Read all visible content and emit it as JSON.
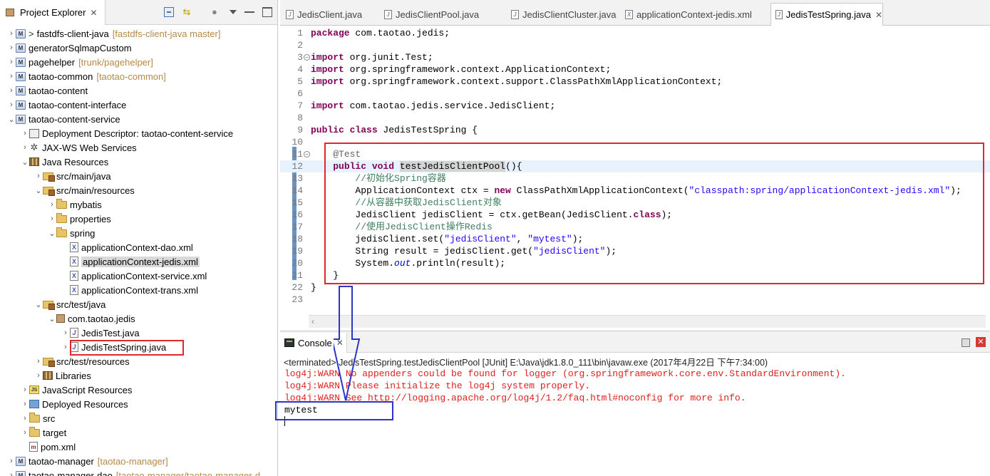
{
  "explorer": {
    "tab_label": "Project Explorer",
    "close_glyph": "✕",
    "tree": [
      {
        "arrow": "›",
        "indent": 0,
        "icon": "project",
        "prefix": ">",
        "label": "fastdfs-client-java",
        "svn": "[fastdfs-client-java master]"
      },
      {
        "arrow": "›",
        "indent": 0,
        "icon": "project",
        "label": "generatorSqlmapCustom"
      },
      {
        "arrow": "›",
        "indent": 0,
        "icon": "project",
        "label": "pagehelper",
        "svn": "[trunk/pagehelper]"
      },
      {
        "arrow": "›",
        "indent": 0,
        "icon": "project",
        "label": "taotao-common",
        "svn": "[taotao-common]"
      },
      {
        "arrow": "›",
        "indent": 0,
        "icon": "project",
        "label": "taotao-content"
      },
      {
        "arrow": "›",
        "indent": 0,
        "icon": "project",
        "label": "taotao-content-interface"
      },
      {
        "arrow": "⌄",
        "indent": 0,
        "icon": "project",
        "label": "taotao-content-service"
      },
      {
        "arrow": "›",
        "indent": 1,
        "icon": "dd",
        "label": "Deployment Descriptor: taotao-content-service"
      },
      {
        "arrow": "›",
        "indent": 1,
        "icon": "jaxws",
        "label": "JAX-WS Web Services"
      },
      {
        "arrow": "⌄",
        "indent": 1,
        "icon": "lib",
        "label": "Java Resources"
      },
      {
        "arrow": "›",
        "indent": 2,
        "icon": "pkgfolder",
        "label": "src/main/java"
      },
      {
        "arrow": "⌄",
        "indent": 2,
        "icon": "pkgfolder",
        "label": "src/main/resources"
      },
      {
        "arrow": "›",
        "indent": 3,
        "icon": "folder",
        "label": "mybatis"
      },
      {
        "arrow": "›",
        "indent": 3,
        "icon": "folder",
        "label": "properties"
      },
      {
        "arrow": "⌄",
        "indent": 3,
        "icon": "folder",
        "label": "spring"
      },
      {
        "arrow": "",
        "indent": 4,
        "icon": "xml",
        "label": "applicationContext-dao.xml"
      },
      {
        "arrow": "",
        "indent": 4,
        "icon": "xml",
        "label": "applicationContext-jedis.xml",
        "selected": true
      },
      {
        "arrow": "",
        "indent": 4,
        "icon": "xml",
        "label": "applicationContext-service.xml"
      },
      {
        "arrow": "",
        "indent": 4,
        "icon": "xml",
        "label": "applicationContext-trans.xml"
      },
      {
        "arrow": "⌄",
        "indent": 2,
        "icon": "pkgfolder",
        "label": "src/test/java"
      },
      {
        "arrow": "⌄",
        "indent": 3,
        "icon": "package",
        "label": "com.taotao.jedis"
      },
      {
        "arrow": "›",
        "indent": 4,
        "icon": "java",
        "label": "JedisTest.java"
      },
      {
        "arrow": "›",
        "indent": 4,
        "icon": "java",
        "label": "JedisTestSpring.java",
        "boxed": true
      },
      {
        "arrow": "›",
        "indent": 2,
        "icon": "pkgfolder",
        "label": "src/test/resources"
      },
      {
        "arrow": "›",
        "indent": 2,
        "icon": "lib",
        "label": "Libraries"
      },
      {
        "arrow": "›",
        "indent": 1,
        "icon": "js",
        "label": "JavaScript Resources"
      },
      {
        "arrow": "›",
        "indent": 1,
        "icon": "deploy",
        "label": "Deployed Resources"
      },
      {
        "arrow": "›",
        "indent": 1,
        "icon": "folder",
        "label": "src"
      },
      {
        "arrow": "›",
        "indent": 1,
        "icon": "folder",
        "label": "target"
      },
      {
        "arrow": "",
        "indent": 1,
        "icon": "pom",
        "label": "pom.xml"
      },
      {
        "arrow": "›",
        "indent": 0,
        "icon": "project",
        "label": "taotao-manager",
        "svn": "[taotao-manager]"
      },
      {
        "arrow": "›",
        "indent": 0,
        "icon": "project",
        "label": "taotao-manager-dao",
        "svn": "[taotao-manager/taotao-manager-d"
      }
    ]
  },
  "editor": {
    "tabs": [
      {
        "label": "JedisClient.java",
        "icon": "J"
      },
      {
        "label": "JedisClientPool.java",
        "icon": "J"
      },
      {
        "label": "JedisClientCluster.java",
        "icon": "J"
      },
      {
        "label": "applicationContext-jedis.xml",
        "icon": "X"
      },
      {
        "label": "JedisTestSpring.java",
        "icon": "J",
        "active": true,
        "close": "✕"
      }
    ],
    "lines": [
      {
        "n": "1",
        "html": "<span class=\"kw\">package</span> com.taotao.jedis;"
      },
      {
        "n": "2",
        "html": ""
      },
      {
        "n": "3",
        "html": "<span class=\"kw\">import</span> org.junit.Test;"
      },
      {
        "n": "4",
        "html": "<span class=\"kw\">import</span> org.springframework.context.ApplicationContext;"
      },
      {
        "n": "5",
        "html": "<span class=\"kw\">import</span> org.springframework.context.support.ClassPathXmlApplicationContext;"
      },
      {
        "n": "6",
        "html": ""
      },
      {
        "n": "7",
        "html": "<span class=\"kw\">import</span> com.taotao.jedis.service.JedisClient;"
      },
      {
        "n": "8",
        "html": ""
      },
      {
        "n": "9",
        "html": "<span class=\"kw\">public class</span> JedisTestSpring {"
      },
      {
        "n": "10",
        "html": ""
      },
      {
        "n": "11",
        "html": "    <span class=\"ann\">@Test</span>"
      },
      {
        "n": "12",
        "html": "    <span class=\"kw\">public void</span> <span class=\"occurrence\">testJedisClientPool</span>(){",
        "current": true
      },
      {
        "n": "13",
        "html": "        <span class=\"com\">//初始化Spring容器</span>"
      },
      {
        "n": "14",
        "html": "        ApplicationContext ctx = <span class=\"kw\">new</span> ClassPathXmlApplicationContext(<span class=\"str\">\"classpath:spring/applicationContext-jedis.xml\"</span>);"
      },
      {
        "n": "15",
        "html": "        <span class=\"com\">//从容器中获取JedisClient对象</span>"
      },
      {
        "n": "16",
        "html": "        JedisClient jedisClient = ctx.getBean(JedisClient.<span class=\"kw\">class</span>);"
      },
      {
        "n": "17",
        "html": "        <span class=\"com\">//使用JedisClient操作Redis</span>"
      },
      {
        "n": "18",
        "html": "        jedisClient.set(<span class=\"str\">\"jedisClient\"</span>, <span class=\"str\">\"mytest\"</span>);"
      },
      {
        "n": "19",
        "html": "        String result = jedisClient.get(<span class=\"str\">\"jedisClient\"</span>);"
      },
      {
        "n": "20",
        "html": "        System.<span class=\"fld\">out</span>.println(result);"
      },
      {
        "n": "21",
        "html": "    }"
      },
      {
        "n": "22",
        "html": "}"
      },
      {
        "n": "23",
        "html": ""
      }
    ]
  },
  "console": {
    "tab_label": "Console",
    "close_glyph": "✕",
    "terminated": "<terminated> JedisTestSpring.testJedisClientPool [JUnit] E:\\Java\\jdk1.8.0_111\\bin\\javaw.exe (2017年4月22日 下午7:34:00)",
    "output": [
      {
        "type": "err",
        "text": "log4j:WARN No appenders could be found for logger (org.springframework.core.env.StandardEnvironment)."
      },
      {
        "type": "err",
        "text": "log4j:WARN Please initialize the log4j system properly."
      },
      {
        "type": "err",
        "text": "log4j:WARN See http://logging.apache.org/log4j/1.2/faq.html#noconfig for more info."
      },
      {
        "type": "std",
        "text": "mytest"
      }
    ]
  },
  "colors": {
    "annotation_red": "#e0262e",
    "annotation_blue": "#2a36c8"
  }
}
